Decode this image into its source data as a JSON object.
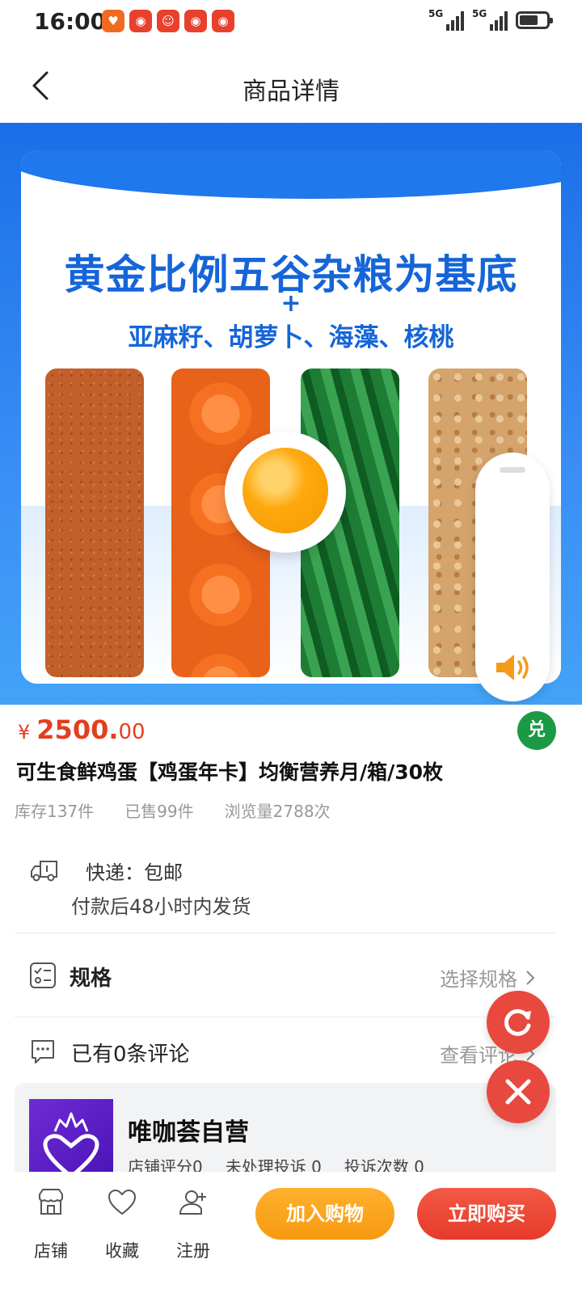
{
  "status_bar": {
    "time": "16:00",
    "network_1": "5G",
    "network_2": "5G",
    "app_icons": [
      "heart-app-icon",
      "chat-app-icon",
      "clown-app-icon",
      "chat-app-icon",
      "chat-app-icon"
    ]
  },
  "header": {
    "title": "商品详情",
    "back_icon": "chevron-left-icon"
  },
  "banner": {
    "headline": "黄金比例五谷杂粮为基底",
    "plus": "+",
    "subline": "亚麻籽、胡萝卜、海藻、核桃",
    "more_icon": "ellipsis-icon",
    "sound_icon": "speaker-icon"
  },
  "product": {
    "currency": "¥",
    "price_int": "2500.",
    "price_dec": "00",
    "exchange_badge": "兑",
    "name": "可生食鲜鸡蛋【鸡蛋年卡】均衡营养月/箱/30枚",
    "stock": "库存137件",
    "sold": "已售99件",
    "views": "浏览量2788次"
  },
  "shipping": {
    "title": "快递：包邮",
    "note": "付款后48小时内发货"
  },
  "spec_row": {
    "label": "规格",
    "action": "选择规格"
  },
  "review_row": {
    "label": "已有0条评论",
    "action": "查看评论"
  },
  "store": {
    "name": "唯咖荟自营",
    "rating": "店铺评分0",
    "pending": "未处理投诉 0",
    "complaints": "投诉次数 0"
  },
  "bottom_bar": {
    "shop": "店铺",
    "favorite": "收藏",
    "register": "注册",
    "add_to_cart": "加入购物",
    "buy_now": "立即购买"
  },
  "colors": {
    "accent": "#e23f1f",
    "banner_blue": "#1565d8",
    "cart_orange": "#f79a10",
    "buy_red": "#e63a2a",
    "fab_red": "#e8493e",
    "badge_green": "#1a9a45"
  }
}
